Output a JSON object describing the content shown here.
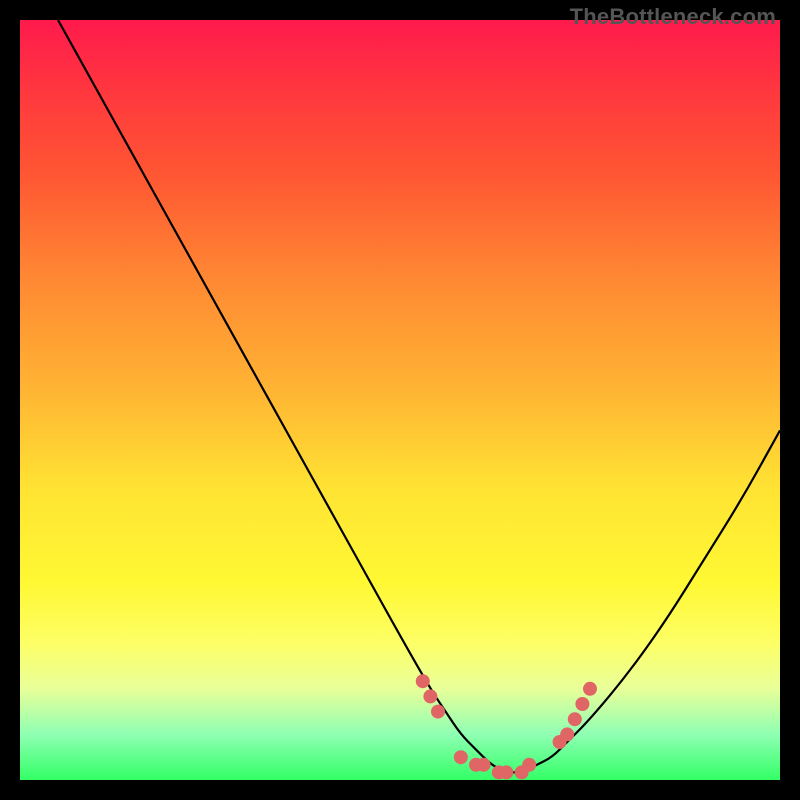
{
  "watermark": "TheBottleneck.com",
  "chart_data": {
    "type": "line",
    "title": "",
    "xlabel": "",
    "ylabel": "",
    "xlim": [
      0,
      100
    ],
    "ylim": [
      0,
      100
    ],
    "grid": false,
    "legend": false,
    "series": [
      {
        "name": "bottleneck-curve",
        "x": [
          5,
          10,
          15,
          20,
          25,
          30,
          35,
          40,
          45,
          50,
          54,
          56,
          58,
          60,
          62,
          64,
          66,
          68,
          70,
          72,
          75,
          80,
          85,
          90,
          95,
          100
        ],
        "y": [
          100,
          91,
          82,
          73,
          64,
          55,
          46,
          37,
          28,
          19,
          12,
          9,
          6,
          4,
          2,
          1,
          1,
          2,
          3,
          5,
          8,
          14,
          21,
          29,
          37,
          46
        ]
      }
    ],
    "markers": {
      "name": "highlight-dots",
      "color": "#e06666",
      "points": [
        {
          "x": 53,
          "y": 13
        },
        {
          "x": 54,
          "y": 11
        },
        {
          "x": 55,
          "y": 9
        },
        {
          "x": 58,
          "y": 3
        },
        {
          "x": 60,
          "y": 2
        },
        {
          "x": 61,
          "y": 2
        },
        {
          "x": 63,
          "y": 1
        },
        {
          "x": 64,
          "y": 1
        },
        {
          "x": 66,
          "y": 1
        },
        {
          "x": 67,
          "y": 2
        },
        {
          "x": 71,
          "y": 5
        },
        {
          "x": 72,
          "y": 6
        },
        {
          "x": 73,
          "y": 8
        },
        {
          "x": 74,
          "y": 10
        },
        {
          "x": 75,
          "y": 12
        }
      ]
    },
    "gradient_stops": [
      {
        "pos": 0.0,
        "color": "#ff1a4d"
      },
      {
        "pos": 0.08,
        "color": "#ff3340"
      },
      {
        "pos": 0.2,
        "color": "#ff5533"
      },
      {
        "pos": 0.34,
        "color": "#ff8833"
      },
      {
        "pos": 0.48,
        "color": "#ffb233"
      },
      {
        "pos": 0.62,
        "color": "#ffe433"
      },
      {
        "pos": 0.74,
        "color": "#fff833"
      },
      {
        "pos": 0.82,
        "color": "#fdff66"
      },
      {
        "pos": 0.88,
        "color": "#e8ff99"
      },
      {
        "pos": 0.94,
        "color": "#8fffb3"
      },
      {
        "pos": 1.0,
        "color": "#33ff66"
      }
    ]
  }
}
